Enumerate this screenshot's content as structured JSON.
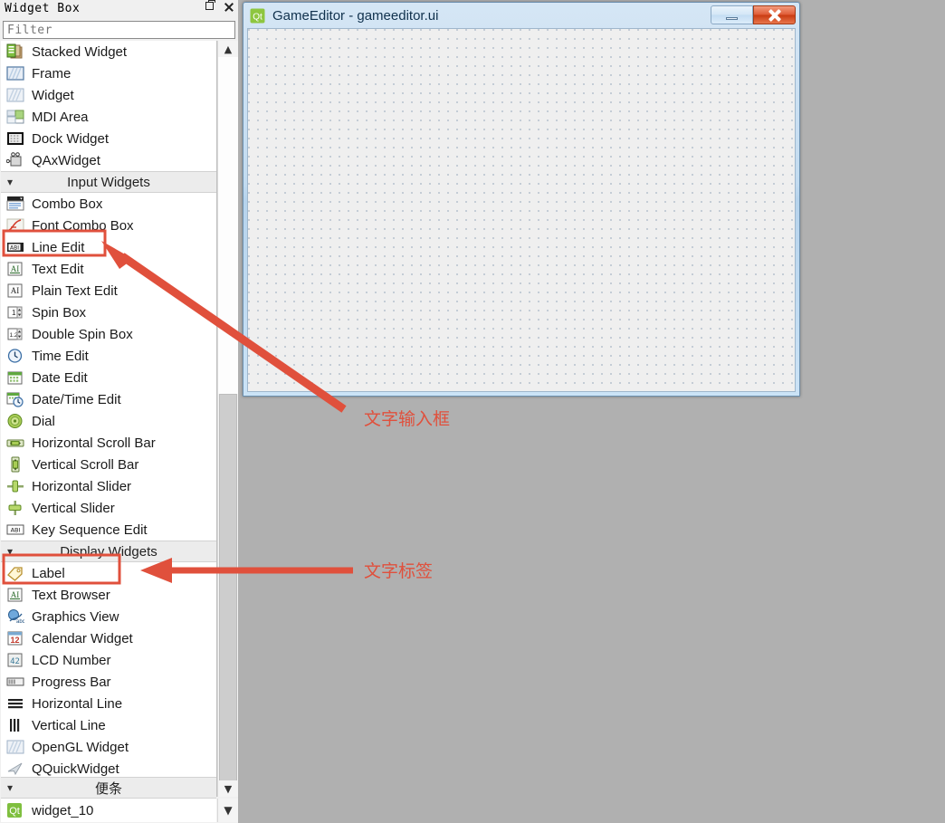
{
  "widget_box": {
    "title": "Widget Box",
    "title_buttons": [
      {
        "name": "float-button",
        "glyph": "float-icon"
      },
      {
        "name": "close-button",
        "glyph": "close-icon"
      }
    ],
    "filter": {
      "placeholder": "Filter",
      "value": ""
    },
    "items": [
      {
        "type": "item",
        "label": "Stacked Widget",
        "icon": "stacked-widget-icon"
      },
      {
        "type": "item",
        "label": "Frame",
        "icon": "frame-icon"
      },
      {
        "type": "item",
        "label": "Widget",
        "icon": "widget-icon"
      },
      {
        "type": "item",
        "label": "MDI Area",
        "icon": "mdi-area-icon"
      },
      {
        "type": "item",
        "label": "Dock Widget",
        "icon": "dock-widget-icon"
      },
      {
        "type": "item",
        "label": "QAxWidget",
        "icon": "qax-widget-icon"
      },
      {
        "type": "category",
        "label": "Input Widgets",
        "chevron": "chevron-down-icon"
      },
      {
        "type": "item",
        "label": "Combo Box",
        "icon": "combo-box-icon"
      },
      {
        "type": "item",
        "label": "Font Combo Box",
        "icon": "font-combo-box-icon"
      },
      {
        "type": "item",
        "label": "Line Edit",
        "icon": "line-edit-icon",
        "highlighted": true
      },
      {
        "type": "item",
        "label": "Text Edit",
        "icon": "text-edit-icon"
      },
      {
        "type": "item",
        "label": "Plain Text Edit",
        "icon": "plain-text-edit-icon"
      },
      {
        "type": "item",
        "label": "Spin Box",
        "icon": "spin-box-icon"
      },
      {
        "type": "item",
        "label": "Double Spin Box",
        "icon": "double-spin-box-icon"
      },
      {
        "type": "item",
        "label": "Time Edit",
        "icon": "time-edit-icon"
      },
      {
        "type": "item",
        "label": "Date Edit",
        "icon": "date-edit-icon"
      },
      {
        "type": "item",
        "label": "Date/Time Edit",
        "icon": "date-time-edit-icon"
      },
      {
        "type": "item",
        "label": "Dial",
        "icon": "dial-icon"
      },
      {
        "type": "item",
        "label": "Horizontal Scroll Bar",
        "icon": "horizontal-scroll-bar-icon"
      },
      {
        "type": "item",
        "label": "Vertical Scroll Bar",
        "icon": "vertical-scroll-bar-icon"
      },
      {
        "type": "item",
        "label": "Horizontal Slider",
        "icon": "horizontal-slider-icon"
      },
      {
        "type": "item",
        "label": "Vertical Slider",
        "icon": "vertical-slider-icon"
      },
      {
        "type": "item",
        "label": "Key Sequence Edit",
        "icon": "key-sequence-edit-icon"
      },
      {
        "type": "category",
        "label": "Display Widgets",
        "chevron": "chevron-down-icon"
      },
      {
        "type": "item",
        "label": "Label",
        "icon": "label-icon",
        "highlighted": true
      },
      {
        "type": "item",
        "label": "Text Browser",
        "icon": "text-browser-icon"
      },
      {
        "type": "item",
        "label": "Graphics View",
        "icon": "graphics-view-icon"
      },
      {
        "type": "item",
        "label": "Calendar Widget",
        "icon": "calendar-widget-icon"
      },
      {
        "type": "item",
        "label": "LCD Number",
        "icon": "lcd-number-icon"
      },
      {
        "type": "item",
        "label": "Progress Bar",
        "icon": "progress-bar-icon"
      },
      {
        "type": "item",
        "label": "Horizontal Line",
        "icon": "horizontal-line-icon"
      },
      {
        "type": "item",
        "label": "Vertical Line",
        "icon": "vertical-line-icon"
      },
      {
        "type": "item",
        "label": "OpenGL Widget",
        "icon": "opengl-widget-icon"
      },
      {
        "type": "item",
        "label": "QQuickWidget",
        "icon": "qquick-widget-icon"
      }
    ],
    "bottom_category": {
      "label": "便条",
      "chevron": "chevron-down-icon"
    },
    "bottom_item": {
      "label": "widget_10",
      "icon": "qt-logo-icon"
    },
    "scrollbar": {
      "up_arrow": "chevron-up-icon",
      "down_arrow": "chevron-down-icon"
    }
  },
  "form_window": {
    "icon": "qt-logo-icon",
    "title": "GameEditor - gameeditor.ui",
    "buttons": {
      "minimize": "minimize-icon",
      "close": "close-icon"
    }
  },
  "annotations": {
    "accent_color": "#e0503c",
    "callout_1": {
      "text": "文字输入框",
      "target": "Line Edit"
    },
    "callout_2": {
      "text": "文字标签",
      "target": "Label"
    }
  }
}
